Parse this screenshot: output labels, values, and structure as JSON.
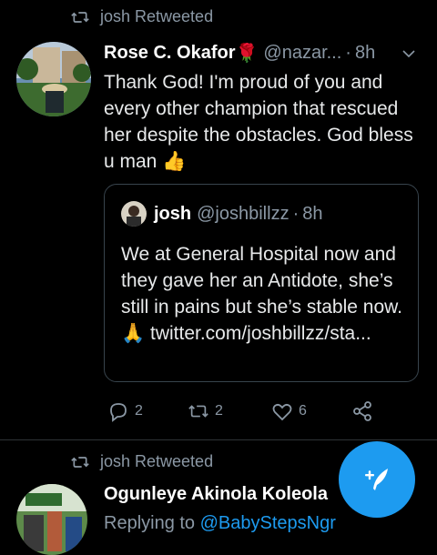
{
  "retweet_header_1": {
    "label": "josh Retweeted"
  },
  "tweet": {
    "author_name": "Rose C. Okafor",
    "author_emoji": "🌹",
    "handle": "@nazar...",
    "separator": "·",
    "time": "8h",
    "text": "Thank God! I'm proud of you and every other champion that rescued her despite the obstacles. God bless u man 👍",
    "quote": {
      "author_name": "josh",
      "handle": "@joshbillzz",
      "separator": "·",
      "time": "8h",
      "text": "We at General Hospital now and they gave her an Antidote, she’s still in pains but she’s stable now. 🙏 ",
      "link": "twitter.com/joshbillzz/sta..."
    },
    "actions": {
      "replies": "2",
      "retweets": "2",
      "likes": "6"
    }
  },
  "retweet_header_2": {
    "label": "josh Retweeted"
  },
  "tweet2": {
    "author_name": "Ogunleye Akinola Koleola",
    "replying_prefix": "Replying to ",
    "replying_to": "@BabyStepsNgr"
  },
  "icons": {
    "retweet": "retweet-icon",
    "reply": "reply-icon",
    "like": "heart-icon",
    "share": "share-icon",
    "compose": "compose-icon",
    "caret": "chevron-down-icon"
  },
  "colors": {
    "background": "#000000",
    "accent": "#1d9bf0",
    "muted": "#8b98a5",
    "border": "#38444d"
  }
}
